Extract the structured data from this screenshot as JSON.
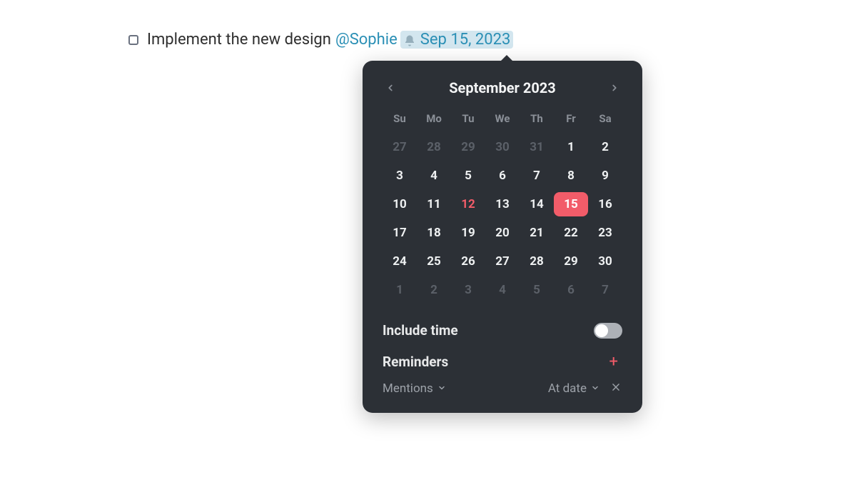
{
  "task": {
    "text": "Implement the new design",
    "mention": "@Sophie",
    "date_label": "Sep 15, 2023"
  },
  "calendar": {
    "month_label": "September 2023",
    "dow": [
      "Su",
      "Mo",
      "Tu",
      "We",
      "Th",
      "Fr",
      "Sa"
    ],
    "weeks": [
      [
        {
          "n": "27",
          "t": "prev"
        },
        {
          "n": "28",
          "t": "prev"
        },
        {
          "n": "29",
          "t": "prev"
        },
        {
          "n": "30",
          "t": "prev"
        },
        {
          "n": "31",
          "t": "prev"
        },
        {
          "n": "1",
          "t": ""
        },
        {
          "n": "2",
          "t": ""
        }
      ],
      [
        {
          "n": "3",
          "t": ""
        },
        {
          "n": "4",
          "t": ""
        },
        {
          "n": "5",
          "t": ""
        },
        {
          "n": "6",
          "t": ""
        },
        {
          "n": "7",
          "t": ""
        },
        {
          "n": "8",
          "t": ""
        },
        {
          "n": "9",
          "t": ""
        }
      ],
      [
        {
          "n": "10",
          "t": ""
        },
        {
          "n": "11",
          "t": ""
        },
        {
          "n": "12",
          "t": "today"
        },
        {
          "n": "13",
          "t": ""
        },
        {
          "n": "14",
          "t": ""
        },
        {
          "n": "15",
          "t": "selected"
        },
        {
          "n": "16",
          "t": ""
        }
      ],
      [
        {
          "n": "17",
          "t": ""
        },
        {
          "n": "18",
          "t": ""
        },
        {
          "n": "19",
          "t": ""
        },
        {
          "n": "20",
          "t": ""
        },
        {
          "n": "21",
          "t": ""
        },
        {
          "n": "22",
          "t": ""
        },
        {
          "n": "23",
          "t": ""
        }
      ],
      [
        {
          "n": "24",
          "t": ""
        },
        {
          "n": "25",
          "t": ""
        },
        {
          "n": "26",
          "t": ""
        },
        {
          "n": "27",
          "t": ""
        },
        {
          "n": "28",
          "t": ""
        },
        {
          "n": "29",
          "t": ""
        },
        {
          "n": "30",
          "t": ""
        }
      ],
      [
        {
          "n": "1",
          "t": "next"
        },
        {
          "n": "2",
          "t": "next"
        },
        {
          "n": "3",
          "t": "next"
        },
        {
          "n": "4",
          "t": "next"
        },
        {
          "n": "5",
          "t": "next"
        },
        {
          "n": "6",
          "t": "next"
        },
        {
          "n": "7",
          "t": "next"
        }
      ]
    ]
  },
  "sections": {
    "include_time": "Include time",
    "reminders": "Reminders"
  },
  "reminder": {
    "type": "Mentions",
    "when": "At date"
  }
}
